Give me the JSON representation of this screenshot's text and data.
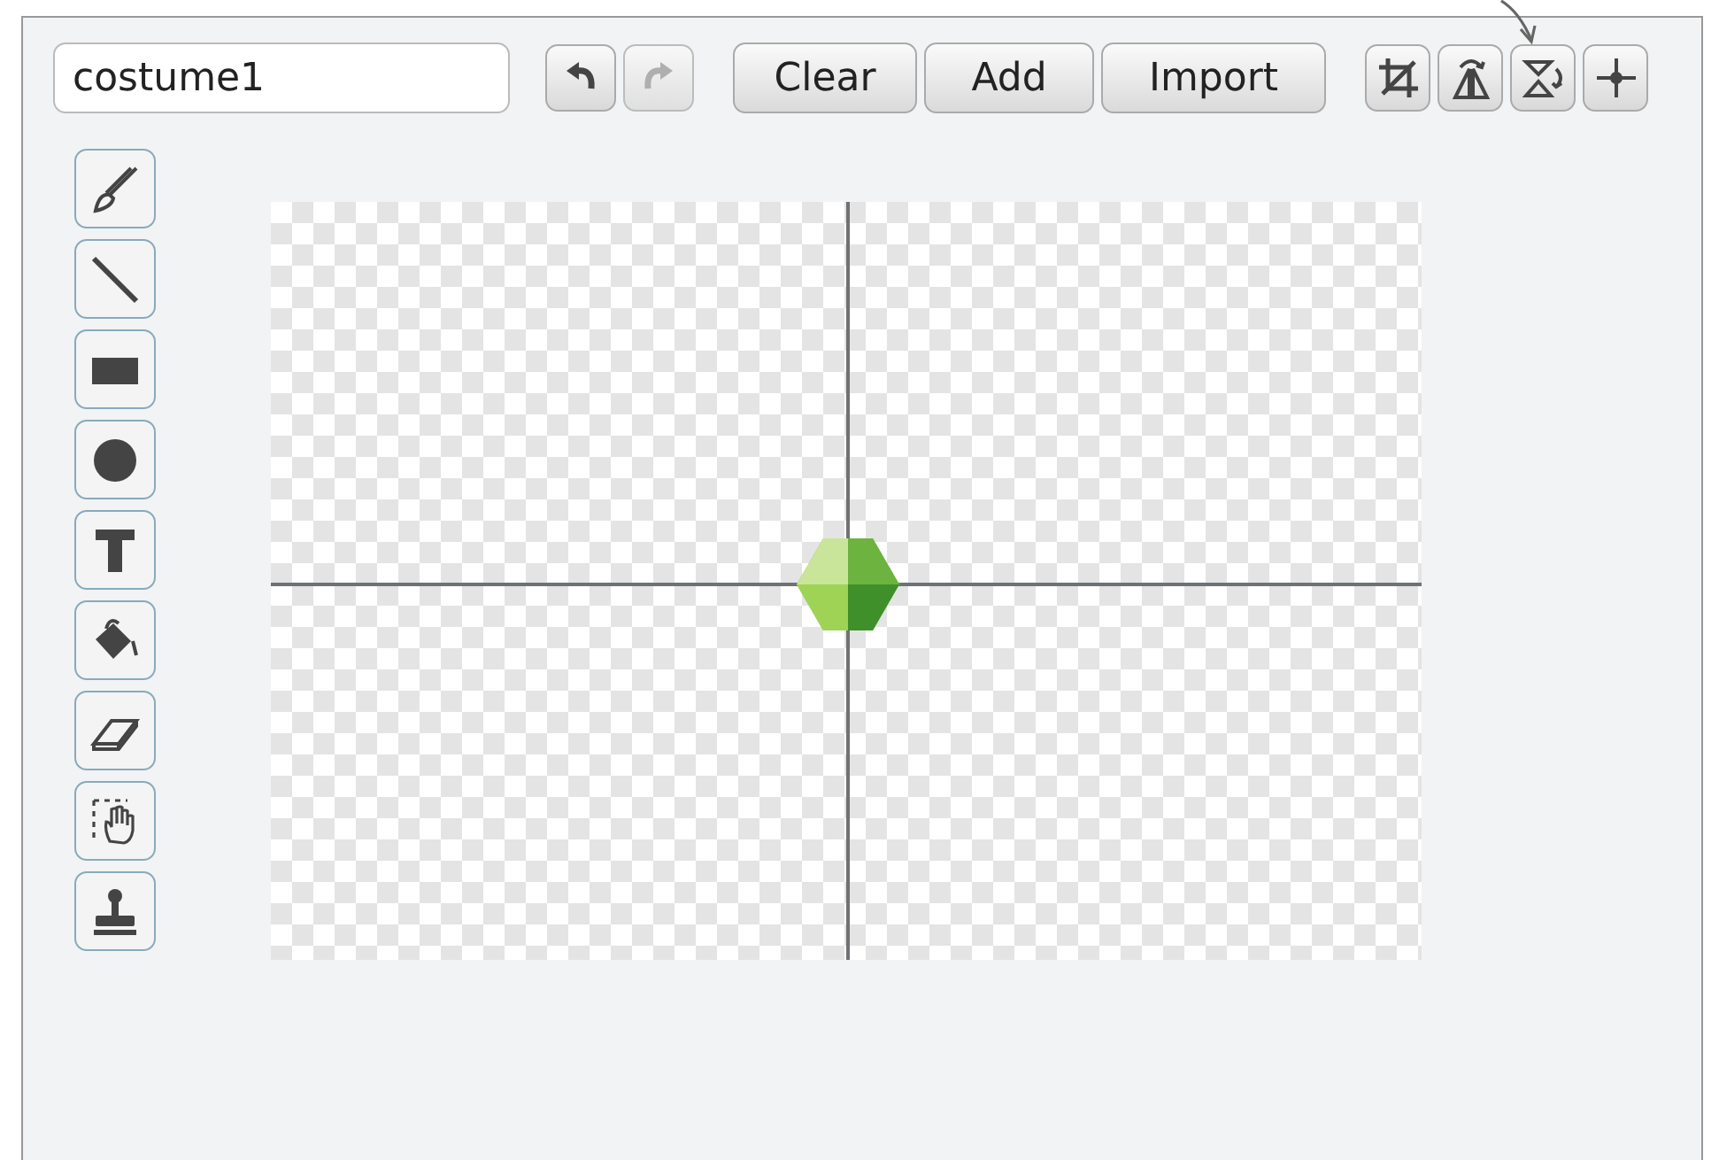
{
  "costume_name": {
    "value": "costume1"
  },
  "history_buttons": [
    {
      "kind": "undo",
      "disabled": false
    },
    {
      "kind": "redo",
      "disabled": true
    }
  ],
  "buttons": [
    "Clear",
    "Add",
    "Import"
  ],
  "transform_buttons": [
    {
      "kind": "crop"
    },
    {
      "kind": "flip-horizontal"
    },
    {
      "kind": "flip-vertical"
    },
    {
      "kind": "set-center"
    }
  ],
  "tools": [
    {
      "kind": "brush"
    },
    {
      "kind": "line"
    },
    {
      "kind": "rectangle"
    },
    {
      "kind": "ellipse"
    },
    {
      "kind": "text"
    },
    {
      "kind": "fill"
    },
    {
      "kind": "eraser"
    },
    {
      "kind": "select"
    },
    {
      "kind": "stamp"
    }
  ]
}
